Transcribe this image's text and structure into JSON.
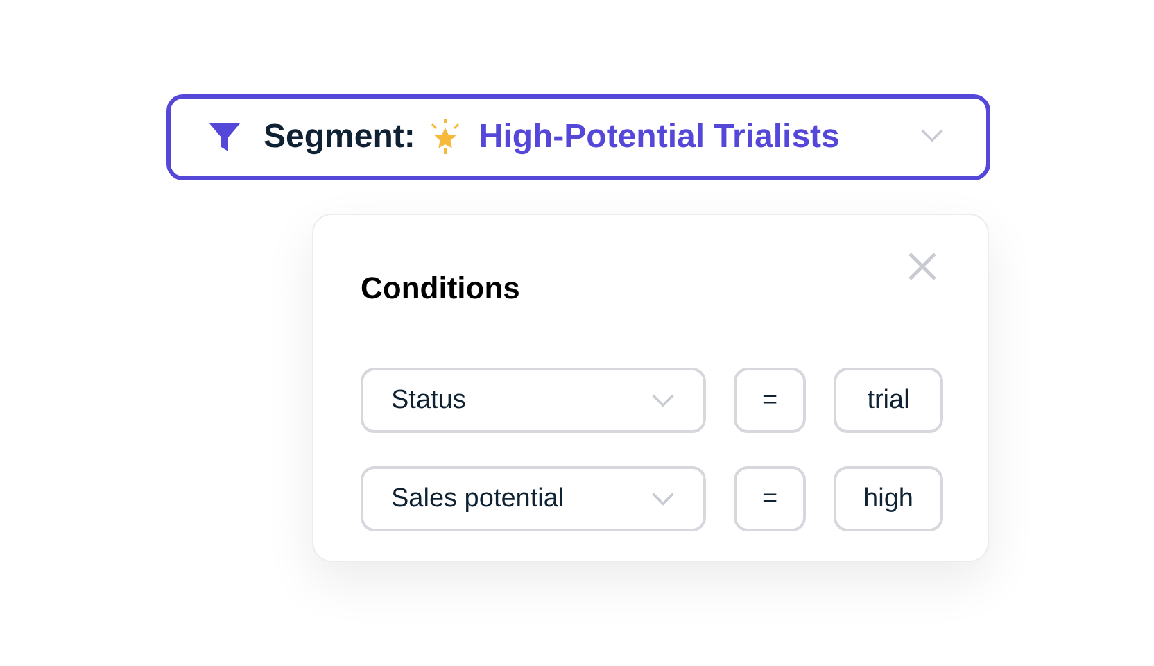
{
  "segment": {
    "label": "Segment:",
    "value": "High-Potential Trialists"
  },
  "conditions": {
    "title": "Conditions",
    "rows": [
      {
        "field": "Status",
        "operator": "=",
        "value": "trial"
      },
      {
        "field": "Sales potential",
        "operator": "=",
        "value": "high"
      }
    ]
  }
}
